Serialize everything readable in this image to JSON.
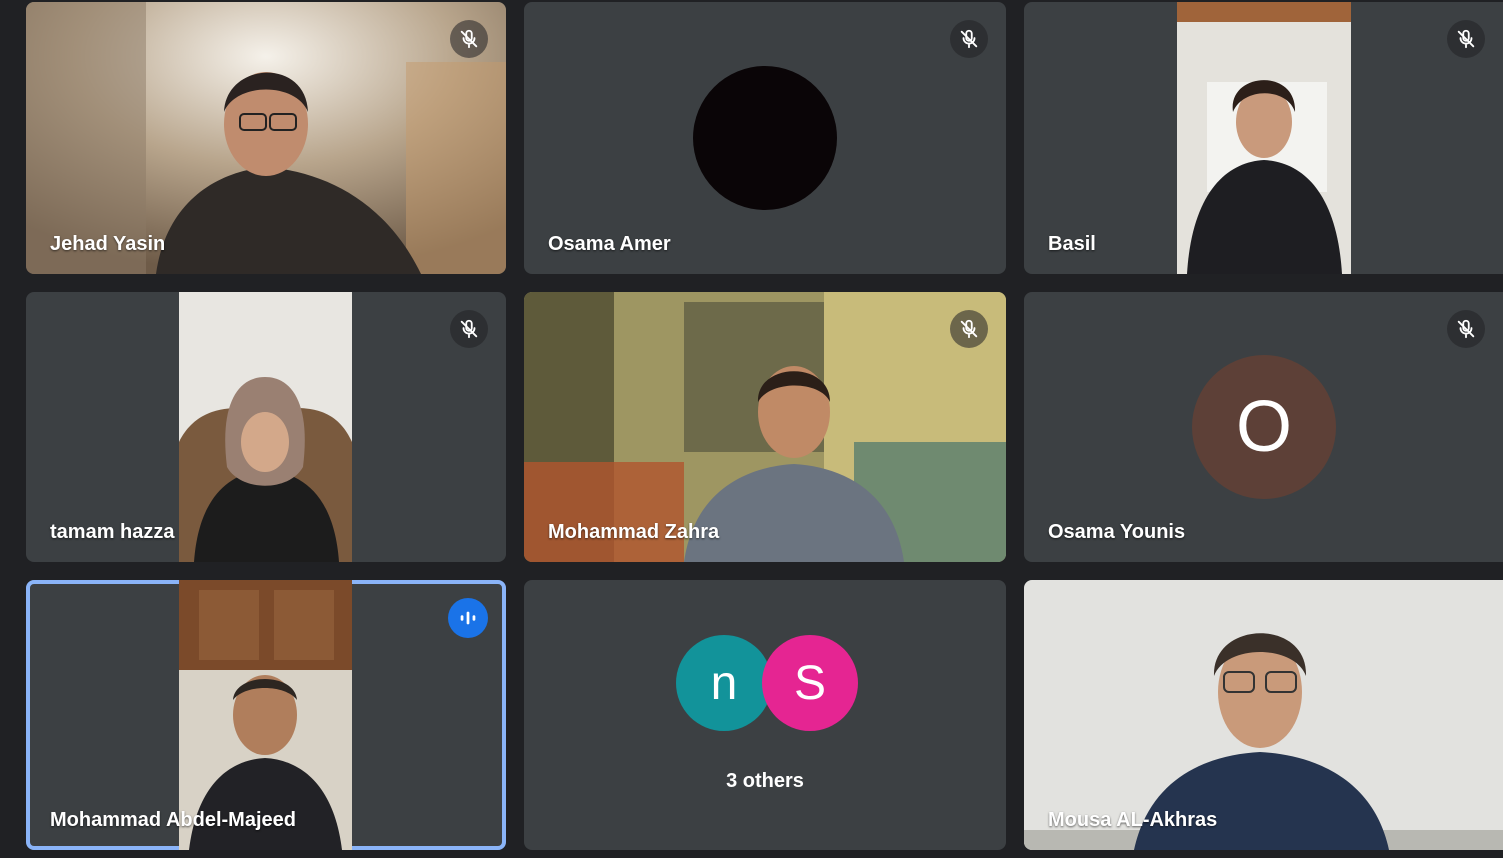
{
  "participants": [
    {
      "name": "Jehad Yasin",
      "muted": true
    },
    {
      "name": "Osama Amer",
      "muted": true
    },
    {
      "name": "Basil",
      "muted": true
    },
    {
      "name": "tamam hazza",
      "muted": true
    },
    {
      "name": "Mohammad Zahra",
      "muted": true
    },
    {
      "name": "Osama Younis",
      "muted": true,
      "avatar_letter": "O",
      "avatar_color": "#5d4037"
    },
    {
      "name": "Mohammad Abdel-Majeed",
      "muted": false,
      "speaking": true
    },
    {
      "name": "Mousa AL-Akhras",
      "muted": false
    }
  ],
  "others": {
    "avatars": [
      {
        "letter": "n",
        "color": "#12939a"
      },
      {
        "letter": "S",
        "color": "#e52592"
      }
    ],
    "label": "3 others"
  },
  "colors": {
    "background": "#202124",
    "tile": "#3c4043",
    "speaking_outline": "#8ab4f8",
    "speaking_indicator": "#1a73e8"
  },
  "icons": {
    "muted": "mic-off-icon",
    "speaking": "audio-level-icon"
  }
}
